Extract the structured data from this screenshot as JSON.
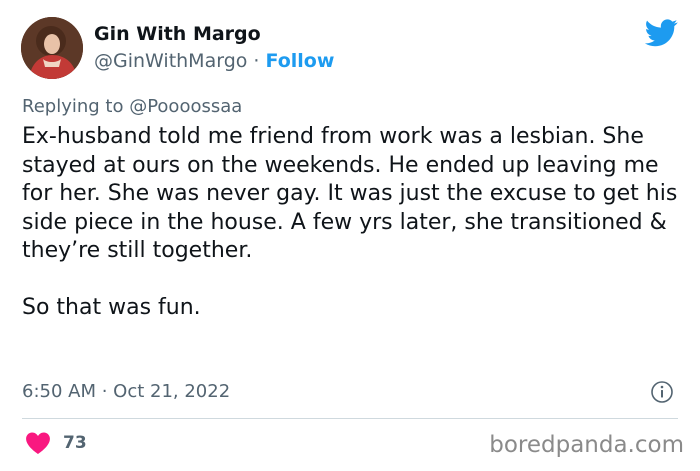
{
  "header": {
    "display_name": "Gin With Margo",
    "handle": "@GinWithMargo",
    "separator": " · ",
    "follow_label": "Follow"
  },
  "reply": {
    "prefix": "Replying to ",
    "handle": "@Poooossaa"
  },
  "tweet": {
    "paragraphs": [
      "Ex-husband told me friend from work was a lesbian. She stayed at ours on the weekends. He ended up leaving me for her. She was never gay. It was just the excuse to get his side piece in the house. A few yrs later, she transitioned & they’re still together.",
      "So that was fun."
    ]
  },
  "meta": {
    "timestamp": "6:50 AM · Oct 21, 2022"
  },
  "footer": {
    "like_count": "73",
    "watermark": "boredpanda.com"
  },
  "icons": {
    "twitter": "twitter-bird-icon",
    "info": "info-icon",
    "like": "heart-icon"
  },
  "colors": {
    "accent": "#1d9bf0",
    "like": "#f91880",
    "secondary_text": "#536471",
    "primary_text": "#0f1419"
  }
}
